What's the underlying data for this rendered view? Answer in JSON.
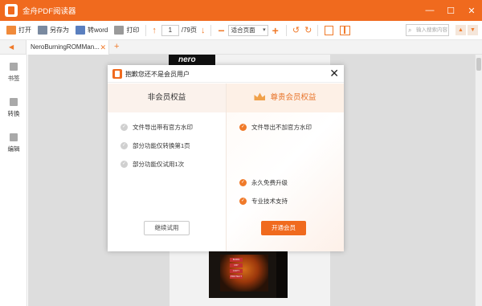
{
  "app": {
    "title": "金舟PDF阅读器"
  },
  "window_controls": {
    "min": "—",
    "max": "☐",
    "close": "✕"
  },
  "toolbar": {
    "open_label": "打开",
    "saveas_label": "另存为",
    "word_label": "转word",
    "print_label": "打印",
    "page_current": "1",
    "page_total": "/79页",
    "zoom_mode": "适合页面",
    "search_placeholder": "输入搜索内容"
  },
  "tabs": [
    {
      "label": "NeroBurningROMMan..."
    }
  ],
  "sidebar": {
    "items": [
      {
        "label": "书签"
      },
      {
        "label": "转换"
      },
      {
        "label": "编辑"
      }
    ]
  },
  "document": {
    "cover_text": "nero",
    "box_tags": [
      "BURN",
      "RIP",
      "COPY",
      "PROTECT"
    ]
  },
  "dialog": {
    "title": "抱歉您还不是会员用户",
    "free_header": "非会员权益",
    "vip_header": "尊贵会员权益",
    "free_features": [
      "文件导出带有官方水印",
      "部分功能仅转换第1页",
      "部分功能仅试用1次"
    ],
    "vip_features": [
      "文件导出不加官方水印",
      "永久免费升级",
      "专业技术支持"
    ],
    "trial_button": "继续试用",
    "member_button": "开通会员"
  },
  "colors": {
    "accent": "#f06a1e",
    "free_bg": "#fbf2ec",
    "vip_bg": "#fdf0e6"
  }
}
